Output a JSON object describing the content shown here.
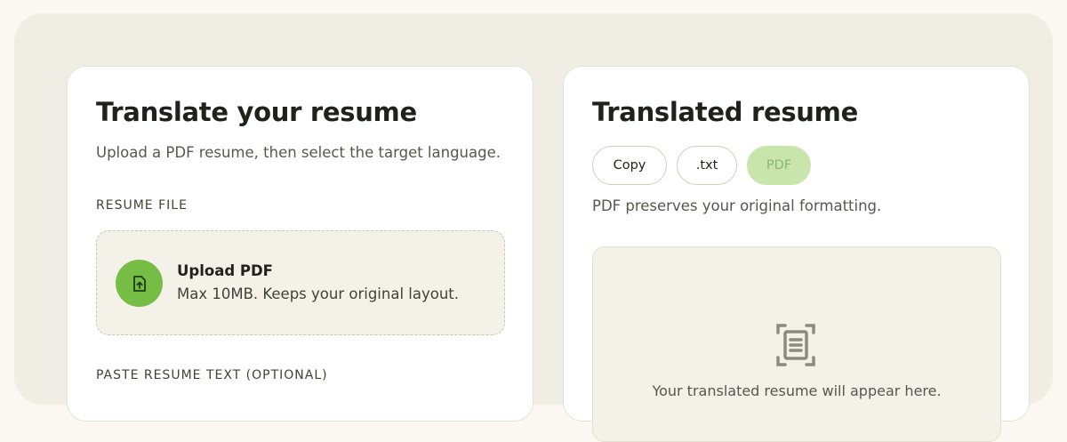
{
  "left_card": {
    "title": "Translate your resume",
    "subtitle": "Upload a PDF resume, then select the target language.",
    "resume_file_label": "RESUME FILE",
    "upload": {
      "title": "Upload PDF",
      "description": "Max 10MB. Keeps your original layout.",
      "icon": "file-upload-icon"
    },
    "paste_label": "PASTE RESUME TEXT (OPTIONAL)"
  },
  "right_card": {
    "title": "Translated resume",
    "buttons": {
      "copy": "Copy",
      "txt": ".txt",
      "pdf": "PDF"
    },
    "note": "PDF preserves your original formatting.",
    "preview": {
      "icon": "document-scan-icon",
      "placeholder": "Your translated resume will appear here."
    }
  },
  "colors": {
    "accent_green": "#76bd45",
    "pdf_button_disabled": "#c8e5ac",
    "page_background": "#faf8f1",
    "panel_background": "#f0ede4"
  }
}
